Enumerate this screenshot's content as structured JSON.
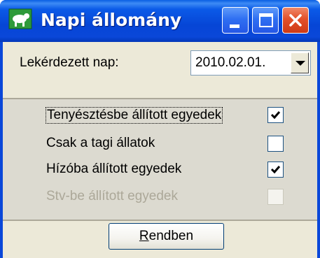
{
  "window": {
    "title": "Napi állomány",
    "icon": "app-icon",
    "controls": [
      "minimize-icon",
      "maximize-icon",
      "close-icon"
    ]
  },
  "date_query": {
    "label": "Lekérdezett nap:",
    "value": "2010.02.01."
  },
  "options": [
    {
      "label": "Tenyésztésbe állított egyedek",
      "checked": true,
      "enabled": true,
      "focused": true
    },
    {
      "label": "Csak a tagi állatok",
      "checked": false,
      "enabled": true
    },
    {
      "label": "Hízóba állított egyedek",
      "checked": true,
      "enabled": true
    },
    {
      "label": "Stv-be állított egyedek",
      "checked": false,
      "enabled": false
    }
  ],
  "ok_button": {
    "accel": "R",
    "rest": "endben"
  },
  "colors": {
    "titlebar": "#0a47d9",
    "face": "#ece9d8",
    "panel": "#dcdad0",
    "disabled_text": "#aca899"
  }
}
